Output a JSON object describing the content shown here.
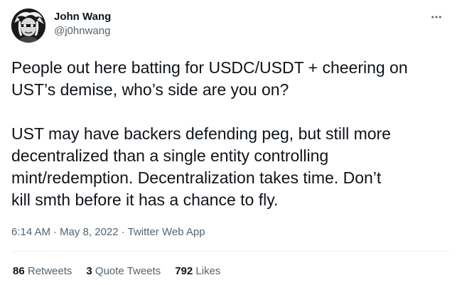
{
  "author": {
    "display_name": "John Wang",
    "handle": "@j0hnwang"
  },
  "tweet": {
    "text": "People out here batting for USDC/USDT + cheering on\nUST’s demise, who’s side are you on?\n\nUST may have backers defending peg, but still more\ndecentralized than a single entity controlling\nmint/redemption. Decentralization takes time. Don’t\nkill smth before it has a chance to fly.",
    "time": "6:14 AM",
    "date": "May 8, 2022",
    "source": "Twitter Web App",
    "separator": "·"
  },
  "stats": {
    "retweets_count": "86",
    "retweets_label": "Retweets",
    "quotes_count": "3",
    "quotes_label": "Quote Tweets",
    "likes_count": "792",
    "likes_label": "Likes"
  },
  "icons": {
    "more": "more-horizontal-icon",
    "avatar": "avatar-image"
  },
  "colors": {
    "text_primary": "#0f1419",
    "text_secondary": "#536471",
    "divider": "#eff3f4"
  }
}
